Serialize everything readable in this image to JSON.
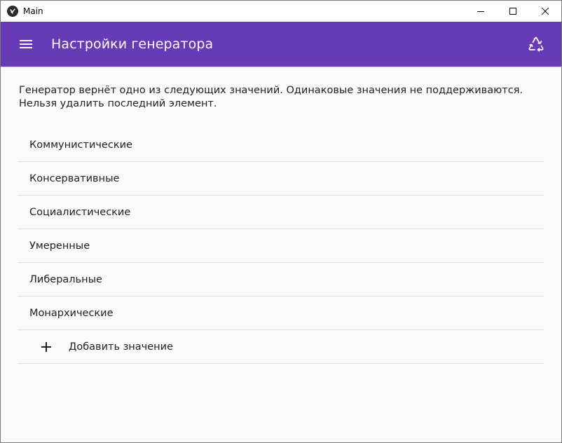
{
  "window": {
    "title": "Main",
    "controls": [
      "minimize",
      "maximize",
      "close"
    ]
  },
  "appbar": {
    "title": "Настройки генератора",
    "background": "#673ab7",
    "menu_icon": "hamburger-menu-icon",
    "action_icon": "recycle-icon"
  },
  "content": {
    "description_line1": "Генератор вернёт одно из следующих значений. Одинаковые значения не поддерживаются.",
    "description_line2": "Нельзя удалить последний элемент.",
    "items": [
      {
        "label": "Коммунистические"
      },
      {
        "label": "Консервативные"
      },
      {
        "label": "Социалистические"
      },
      {
        "label": "Умеренные"
      },
      {
        "label": "Либеральные"
      },
      {
        "label": "Монархические"
      }
    ],
    "add_label": "Добавить значение"
  }
}
